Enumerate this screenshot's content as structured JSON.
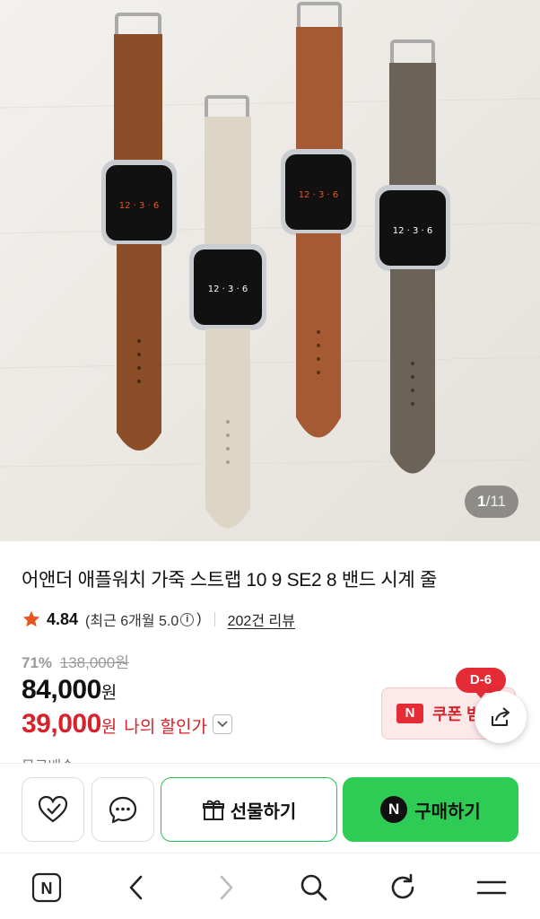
{
  "gallery": {
    "current": "1",
    "separator": "/",
    "total": "11"
  },
  "product": {
    "title": "어앤더 애플워치 가죽 스트랩 10 9 SE2 8 밴드 시계 줄",
    "rating": "4.84",
    "recent_rating_prefix": "(최근 6개월 5.0",
    "recent_rating_suffix": ")",
    "info_glyph": "i",
    "review_count": "202건 리뷰",
    "discount_rate": "71%",
    "original_price": "138,000원",
    "price": "84,000",
    "price_unit": "원",
    "my_price": "39,000",
    "my_price_unit": "원",
    "my_price_label": "나의 할인가",
    "shipping_partial": "무료배송"
  },
  "coupon": {
    "badge": "N",
    "label": "쿠폰 받",
    "dday": "D-6"
  },
  "actions": {
    "gift_label": "선물하기",
    "buy_badge": "N",
    "buy_label": "구매하기"
  },
  "browser": {
    "home_badge": "N"
  },
  "colors": {
    "accent_green": "#2ecc55",
    "sale_red": "#d6222b",
    "star_orange": "#e8541e",
    "strap_brown": "#8c4e28",
    "strap_tan": "#a55a33",
    "strap_cream": "#ddd5c6",
    "strap_taupe": "#6b6258"
  }
}
